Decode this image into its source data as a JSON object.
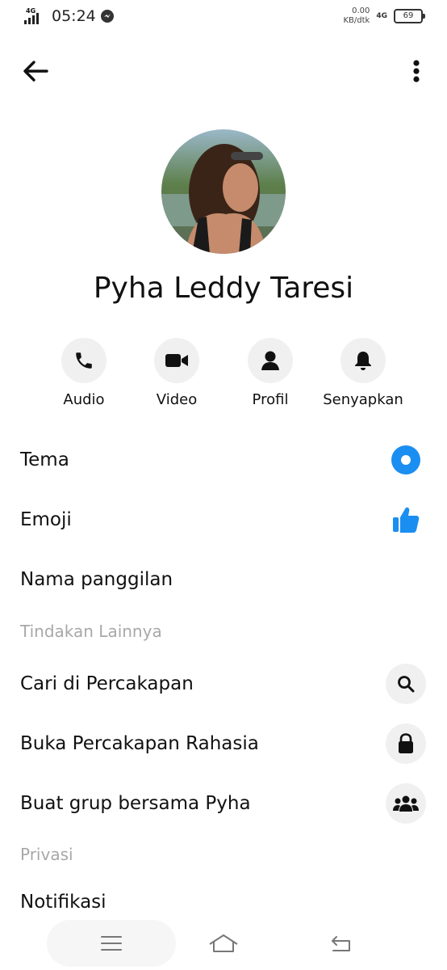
{
  "status": {
    "network_label": "4G",
    "time": "05:24",
    "speed_value": "0.00",
    "speed_unit": "KB/dtk",
    "network_right": "4G",
    "battery": "69"
  },
  "contact": {
    "name": "Pyha Leddy Taresi"
  },
  "actions": [
    {
      "label": "Audio",
      "icon": "phone-icon"
    },
    {
      "label": "Video",
      "icon": "video-camera-icon"
    },
    {
      "label": "Profil",
      "icon": "person-icon"
    },
    {
      "label": "Senyapkan",
      "icon": "bell-icon"
    }
  ],
  "settings": [
    {
      "label": "Tema",
      "icon": "theme-circle-icon"
    },
    {
      "label": "Emoji",
      "icon": "thumbs-up-icon"
    },
    {
      "label": "Nama panggilan"
    }
  ],
  "more_actions": {
    "header": "Tindakan Lainnya",
    "items": [
      {
        "label": "Cari di Percakapan",
        "icon": "search-icon"
      },
      {
        "label": "Buka Percakapan Rahasia",
        "icon": "lock-icon"
      },
      {
        "label": "Buat grup bersama Pyha",
        "icon": "group-icon"
      }
    ]
  },
  "privacy": {
    "header": "Privasi",
    "items": [
      {
        "label": "Notifikasi"
      }
    ]
  },
  "colors": {
    "accent": "#1B8EF2",
    "icon_bg": "#F0F0F0",
    "section_text": "#A8A8A8"
  }
}
